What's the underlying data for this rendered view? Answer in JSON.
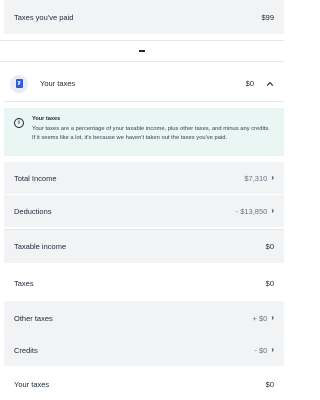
{
  "taxes_paid": {
    "label": "Taxes you've paid",
    "value": "$99"
  },
  "header": {
    "label": "Your taxes",
    "value": "$0"
  },
  "info": {
    "title": "Your taxes",
    "body": "Your taxes are a percentage of your taxable income, plus other taxes, and minus any credits. If it seems like a lot, it's because we haven't taken out the taxes you've paid."
  },
  "rows": {
    "total_income": {
      "label": "Total Income",
      "value": "$7,310"
    },
    "deductions": {
      "label": "Deductions",
      "value": "- $13,850"
    },
    "taxable_income": {
      "label": "Taxable income",
      "value": "$0"
    },
    "taxes": {
      "label": "Taxes",
      "value": "$0"
    },
    "other_taxes": {
      "label": "Other taxes",
      "value": "+ $0"
    },
    "credits": {
      "label": "Credits",
      "value": "- $0"
    },
    "your_taxes": {
      "label": "Your taxes",
      "value": "$0"
    }
  },
  "icons": {
    "receipt": "receipt-icon",
    "chevron": "chevron-right-icon",
    "collapse": "chevron-up-icon",
    "info": "info-icon"
  }
}
